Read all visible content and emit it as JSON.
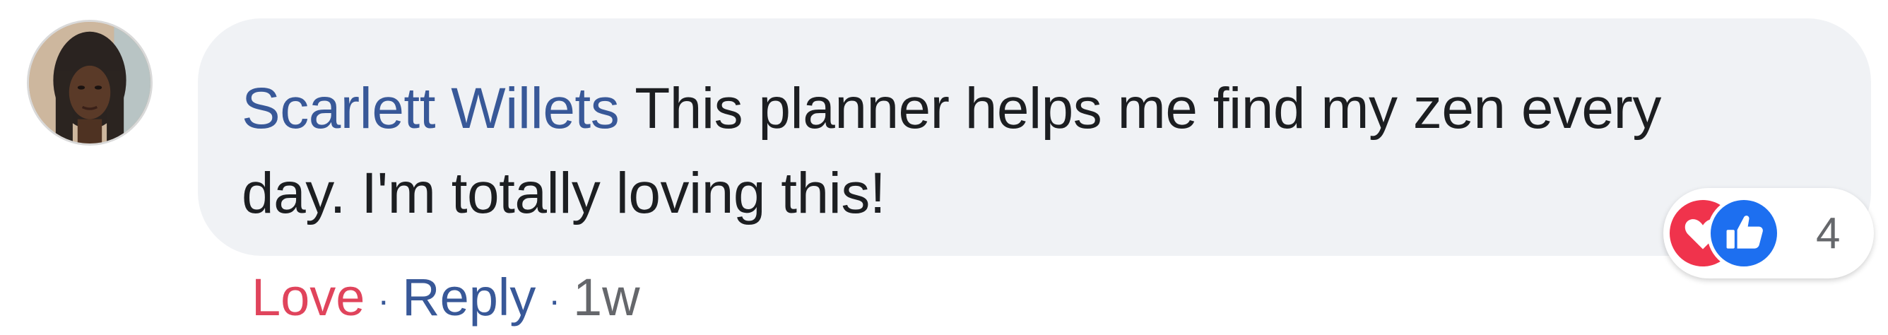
{
  "comment": {
    "avatar_icon": "user-avatar",
    "author": "Scarlett Willets",
    "text": "This planner helps me find my zen every day. I'm totally loving this!"
  },
  "reactions": {
    "icons": [
      "heart-icon",
      "thumbs-up-icon"
    ],
    "count": "4",
    "colors": {
      "love": "#f0334c",
      "like": "#1d6ff0"
    }
  },
  "actions": {
    "love_label": "Love",
    "reply_label": "Reply",
    "separator": "·",
    "timestamp": "1w"
  },
  "colors": {
    "bubble_bg": "#f0f2f5",
    "author_link": "#385898",
    "love_text": "#e0445c",
    "meta_text": "#65676b"
  }
}
